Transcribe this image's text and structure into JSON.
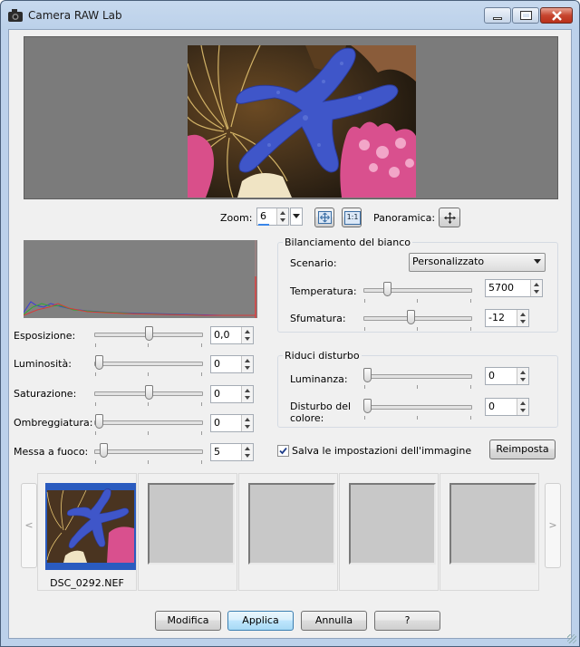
{
  "window": {
    "title": "Camera RAW Lab"
  },
  "zoom": {
    "label": "Zoom:",
    "value": "6",
    "fit_label": "fit",
    "one_to_one": "1:1",
    "pan_label": "Panoramica:"
  },
  "adjust": [
    {
      "label": "Esposizione:",
      "value": "0,0",
      "level_pct": 50
    },
    {
      "label": "Luminosità:",
      "value": "0",
      "level_pct": 0
    },
    {
      "label": "Saturazione:",
      "value": "0",
      "level_pct": 50
    },
    {
      "label": "Ombreggiatura:",
      "value": "0",
      "level_pct": 0
    },
    {
      "label": "Messa a fuoco:",
      "value": "5",
      "level_pct": 5
    }
  ],
  "white_balance": {
    "title": "Bilanciamento del bianco",
    "scenario_label": "Scenario:",
    "scenario_value": "Personalizzato",
    "temperature_label": "Temperatura:",
    "temperature_value": "5700",
    "tint_label": "Sfumatura:",
    "tint_value": "-12"
  },
  "noise": {
    "title": "Riduci disturbo",
    "luminance_label": "Luminanza:",
    "luminance_value": "0",
    "color_label": "Disturbo del colore:",
    "color_value": "0"
  },
  "save_settings": {
    "label": "Salva le impostazioni dell'immagine",
    "checked": true
  },
  "reset_label": "Reimposta",
  "thumbnails": {
    "prev": "<",
    "next": ">",
    "first_name": "DSC_0292.NEF"
  },
  "buttons": {
    "modify": "Modifica",
    "apply": "Applica",
    "cancel": "Annulla",
    "help": "?"
  }
}
